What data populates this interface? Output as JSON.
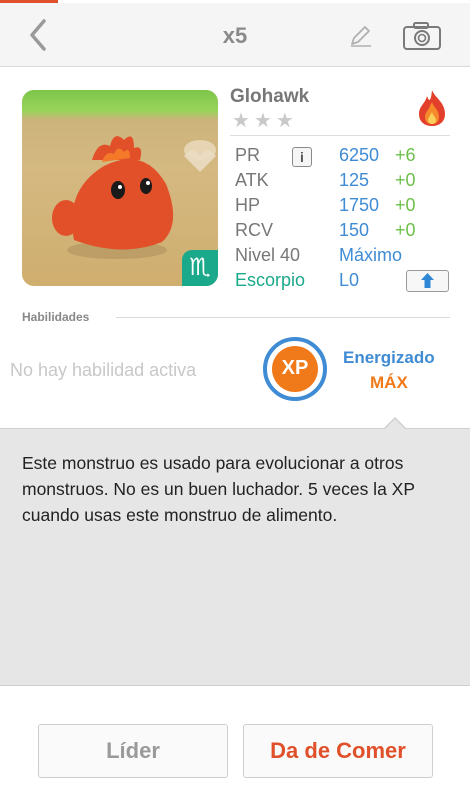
{
  "header": {
    "title": "x5"
  },
  "monster": {
    "name": "Glohawk",
    "stars": [
      "★",
      "★",
      "★"
    ],
    "zodiac_symbol": "♏"
  },
  "stats": {
    "pr": {
      "label": "PR",
      "value": "6250",
      "bonus": "+6",
      "info": "i"
    },
    "atk": {
      "label": "ATK",
      "value": "125",
      "bonus": "+0"
    },
    "hp": {
      "label": "HP",
      "value": "1750",
      "bonus": "+0"
    },
    "rcv": {
      "label": "RCV",
      "value": "150",
      "bonus": "+0"
    },
    "level": {
      "label": "Nivel 40",
      "value": "Máximo"
    },
    "zodiac": {
      "label": "Escorpio",
      "value": "L0"
    }
  },
  "abilities": {
    "section_title": "Habilidades",
    "empty_text": "No hay habilidad activa",
    "xp_badge": "XP",
    "energy_title": "Energizado",
    "energy_level": "MÁX"
  },
  "description": "Este monstruo es usado para evolucionar a otros monstruos. No es un buen luchador. 5 veces la XP cuando usas este monstruo de alimento.",
  "buttons": {
    "leader": "Líder",
    "feed": "Da de Comer"
  },
  "colors": {
    "accent": "#e0502a",
    "blue": "#3f8bd4",
    "green": "#6cc04a",
    "teal": "#1aa98a",
    "orange": "#f07a1a"
  }
}
